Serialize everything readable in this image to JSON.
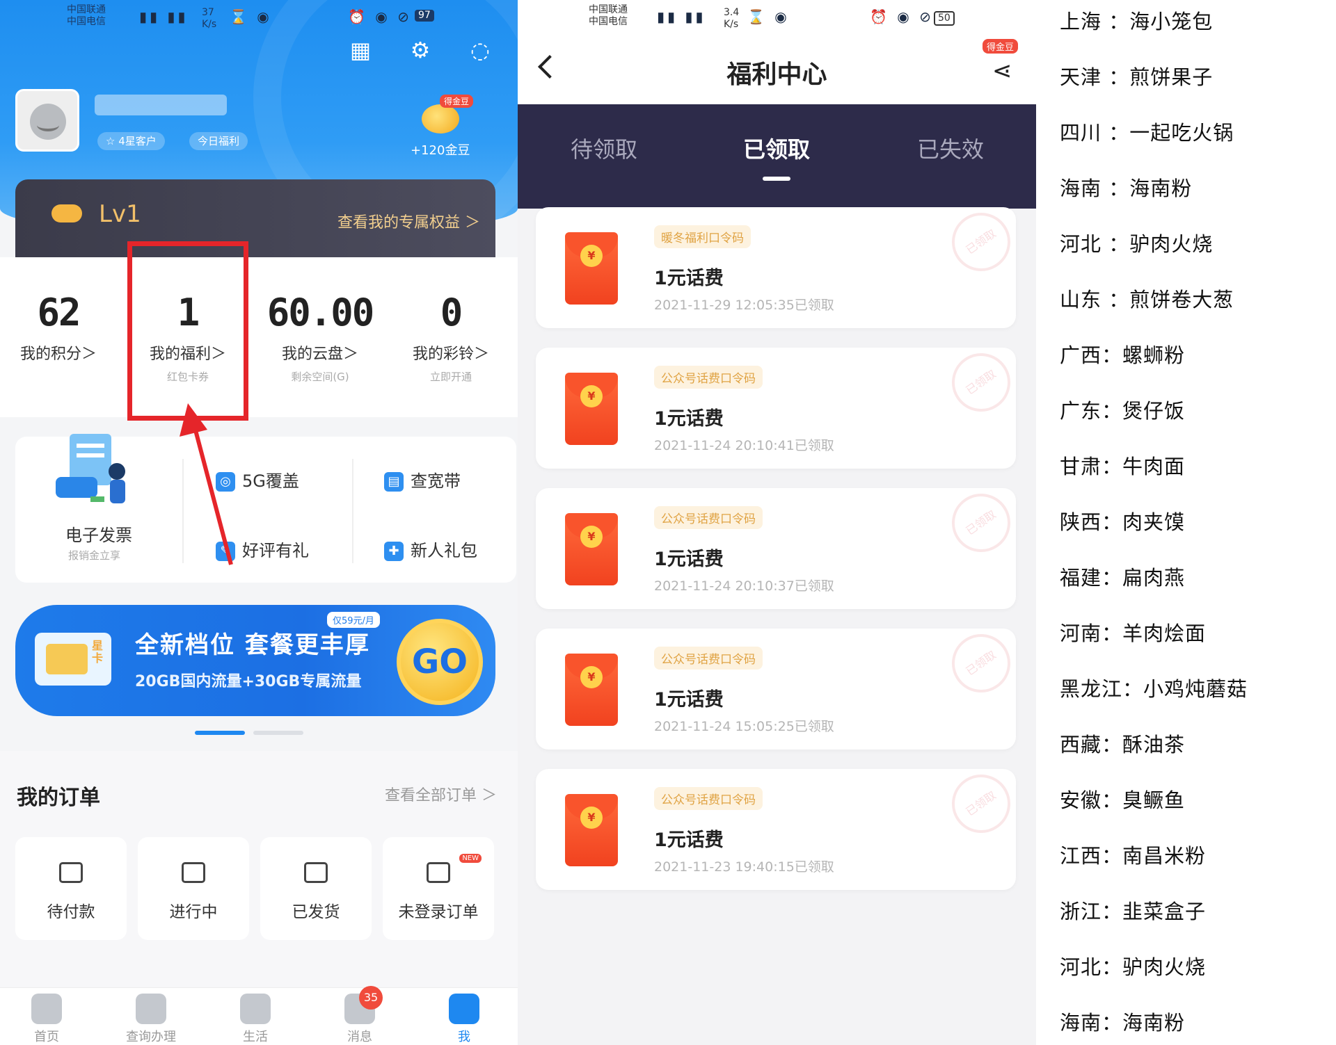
{
  "left_app": {
    "status": {
      "carrier1": "中国联通",
      "carrier2": "中国电信",
      "hd": "HD",
      "net": "4G",
      "speed": "37",
      "unit": "K/s",
      "battery": "97"
    },
    "header_icons": [
      "qrcode-icon",
      "gear-icon",
      "message-icon"
    ],
    "user": {
      "badge1": "☆ 4星客户",
      "badge2": "今日福利",
      "coin_badge": "得金豆",
      "coin_label": "+120金豆"
    },
    "level": {
      "name": "Lv1",
      "link": "查看我的专属权益 ＞"
    },
    "stats": [
      {
        "num": "62",
        "label": "我的积分＞",
        "sub": ""
      },
      {
        "num": "1",
        "label": "我的福利＞",
        "sub": "红包卡券"
      },
      {
        "num": "60.00",
        "label": "我的云盘＞",
        "sub": "剩余空间(G)"
      },
      {
        "num": "0",
        "label": "我的彩铃＞",
        "sub": "立即开通"
      }
    ],
    "services": {
      "invoice": {
        "label": "电子发票",
        "sub": "报销金立享"
      },
      "items": [
        "5G覆盖",
        "查宽带",
        "好评有礼",
        "新人礼包"
      ]
    },
    "banner": {
      "title": "全新档位  套餐更丰厚",
      "subtitle": "20GB国内流量+30GB专属流量",
      "tag": "仅59元/月",
      "go": "GO",
      "sim_text": "星卡"
    },
    "orders": {
      "title": "我的订单",
      "all": "查看全部订单 ＞",
      "items": [
        "待付款",
        "进行中",
        "已发货",
        "未登录订单"
      ],
      "new_tag": "NEW"
    },
    "tabbar": {
      "items": [
        "首页",
        "查询办理",
        "生活",
        "消息",
        "我"
      ],
      "message_badge": "35"
    }
  },
  "right_app": {
    "status": {
      "carrier1": "中国联通",
      "carrier2": "中国电信",
      "hd": "HD",
      "speed": "3.4",
      "unit": "K/s",
      "battery": "50"
    },
    "title": "福利中心",
    "share_tag": "得金豆",
    "tabs": [
      "待领取",
      "已领取",
      "已失效"
    ],
    "active_tab": "已领取",
    "records": [
      {
        "tag": "暖冬福利口令码",
        "name": "1元话费",
        "time": "2021-11-29 12:05:35已领取",
        "stamp": "已领取"
      },
      {
        "tag": "公众号话费口令码",
        "name": "1元话费",
        "time": "2021-11-24 20:10:41已领取",
        "stamp": "已领取"
      },
      {
        "tag": "公众号话费口令码",
        "name": "1元话费",
        "time": "2021-11-24 20:10:37已领取",
        "stamp": "已领取"
      },
      {
        "tag": "公众号话费口令码",
        "name": "1元话费",
        "time": "2021-11-24 15:05:25已领取",
        "stamp": "已领取"
      },
      {
        "tag": "公众号话费口令码",
        "name": "1元话费",
        "time": "2021-11-23 19:40:15已领取",
        "stamp": "已领取"
      }
    ]
  },
  "food_list": [
    "上海 ：海小笼包",
    "天津 ：煎饼果子",
    "四川 ：一起吃火锅",
    "海南 ：海南粉",
    "河北 ：驴肉火烧",
    "山东 ：煎饼卷大葱",
    "广西：螺蛳粉",
    "广东：煲仔饭",
    "甘肃：牛肉面",
    "陕西：肉夹馍",
    "福建：扁肉燕",
    "河南：羊肉烩面",
    "黑龙江：小鸡炖蘑菇",
    "西藏：酥油茶",
    "安徽：臭鳜鱼",
    "江西：南昌米粉",
    "浙江：韭菜盒子",
    "河北：驴肉火烧",
    "海南：海南粉"
  ],
  "colors": {
    "brand_blue": "#1e8ef0",
    "highlight_red": "#e5252a",
    "dark_tabs": "#2d2b4a",
    "envelope_red": "#f1421f"
  }
}
